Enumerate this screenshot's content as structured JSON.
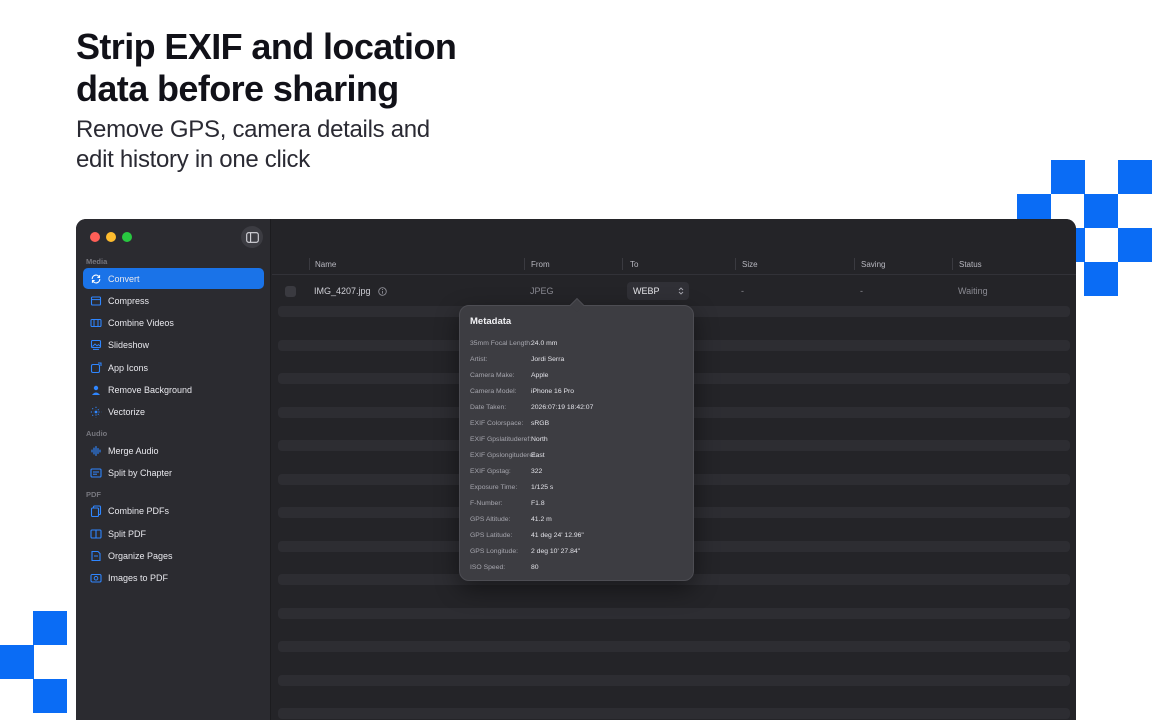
{
  "hero": {
    "title_line1": "Strip EXIF and location",
    "title_line2": "data before sharing",
    "subtitle_line1": "Remove GPS, camera details and",
    "subtitle_line2": "edit history in one click"
  },
  "colors": {
    "accent": "#0a6cf5",
    "active_nav": "#1a73e8",
    "window_bg": "#242428"
  },
  "sidebar": {
    "toggle_icon": "sidebar-toggle-icon",
    "sections": [
      {
        "label": "Media",
        "items": [
          {
            "label": "Convert",
            "icon": "convert-icon",
            "active": true
          },
          {
            "label": "Compress",
            "icon": "compress-icon"
          },
          {
            "label": "Combine Videos",
            "icon": "combine-videos-icon"
          },
          {
            "label": "Slideshow",
            "icon": "slideshow-icon"
          },
          {
            "label": "App Icons",
            "icon": "app-icons-icon"
          },
          {
            "label": "Remove Background",
            "icon": "remove-background-icon"
          },
          {
            "label": "Vectorize",
            "icon": "vectorize-icon"
          }
        ]
      },
      {
        "label": "Audio",
        "items": [
          {
            "label": "Merge Audio",
            "icon": "waveform-icon"
          },
          {
            "label": "Split by Chapter",
            "icon": "chapter-icon"
          }
        ]
      },
      {
        "label": "PDF",
        "items": [
          {
            "label": "Combine PDFs",
            "icon": "combine-pdfs-icon"
          },
          {
            "label": "Split PDF",
            "icon": "split-pdf-icon"
          },
          {
            "label": "Organize Pages",
            "icon": "organize-pages-icon"
          },
          {
            "label": "Images to PDF",
            "icon": "images-to-pdf-icon"
          }
        ]
      }
    ]
  },
  "table": {
    "columns": [
      "Name",
      "From",
      "To",
      "Size",
      "Saving",
      "Status"
    ],
    "rows": [
      {
        "name": "IMG_4207.jpg",
        "from": "JPEG",
        "to": "WEBP",
        "size": "-",
        "saving": "-",
        "status": "Waiting"
      }
    ]
  },
  "metadata_popover": {
    "title": "Metadata",
    "entries": [
      {
        "key": "35mm Focal Length:",
        "value": "24.0 mm"
      },
      {
        "key": "Artist:",
        "value": "Jordi Serra"
      },
      {
        "key": "Camera Make:",
        "value": "Apple"
      },
      {
        "key": "Camera Model:",
        "value": "iPhone 16 Pro"
      },
      {
        "key": "Date Taken:",
        "value": "2026:07:19 18:42:07"
      },
      {
        "key": "EXIF Colorspace:",
        "value": "sRGB"
      },
      {
        "key": "EXIF Gpslatituderef:",
        "value": "North"
      },
      {
        "key": "EXIF Gpslongituderef:",
        "value": "East"
      },
      {
        "key": "EXIF Gpstag:",
        "value": "322"
      },
      {
        "key": "Exposure Time:",
        "value": "1/125 s"
      },
      {
        "key": "F-Number:",
        "value": "F1.8"
      },
      {
        "key": "GPS Altitude:",
        "value": "41.2 m"
      },
      {
        "key": "GPS Latitude:",
        "value": "41 deg 24' 12.96\""
      },
      {
        "key": "GPS Longitude:",
        "value": "2 deg 10' 27.84\""
      },
      {
        "key": "ISO Speed:",
        "value": "80"
      }
    ]
  }
}
